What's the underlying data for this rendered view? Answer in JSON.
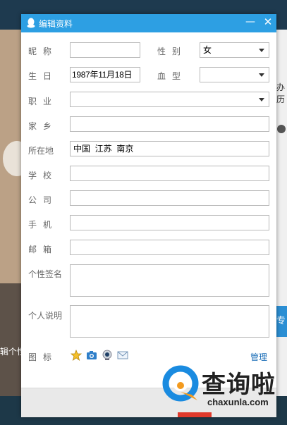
{
  "background": {
    "right_cut_text": "办历",
    "right_button_text": "专",
    "left_cut_text": "辑个性"
  },
  "dialog": {
    "title": "编辑资料",
    "minimize_glyph": "—",
    "close_glyph": "✕",
    "fields": {
      "nickname": {
        "label": "昵称",
        "value": ""
      },
      "gender": {
        "label": "性别",
        "value": "女"
      },
      "birthday": {
        "label": "生日",
        "value": "1987年11月18日"
      },
      "blood_type": {
        "label": "血型",
        "value": ""
      },
      "occupation": {
        "label": "职业",
        "value": ""
      },
      "hometown": {
        "label": "家乡",
        "value": ""
      },
      "location": {
        "label": "所在地",
        "value": "中国  江苏  南京"
      },
      "school": {
        "label": "学校",
        "value": ""
      },
      "company": {
        "label": "公司",
        "value": ""
      },
      "phone": {
        "label": "手机",
        "value": ""
      },
      "email": {
        "label": "邮箱",
        "value": ""
      },
      "signature": {
        "label": "个性签名",
        "value": ""
      },
      "description": {
        "label": "个人说明",
        "value": ""
      },
      "icons": {
        "label": "图标"
      }
    },
    "icon_names": [
      "star-icon",
      "camera-icon",
      "webcam-icon",
      "mail-icon"
    ],
    "manage_label": "管理"
  },
  "watermark": {
    "text": "查询啦",
    "url": "chaxunla.com"
  },
  "colors": {
    "titlebar": "#2d9fe3",
    "link": "#1d6fb8",
    "watermark_blue": "#1a8be0",
    "watermark_orange": "#f39a1e"
  }
}
